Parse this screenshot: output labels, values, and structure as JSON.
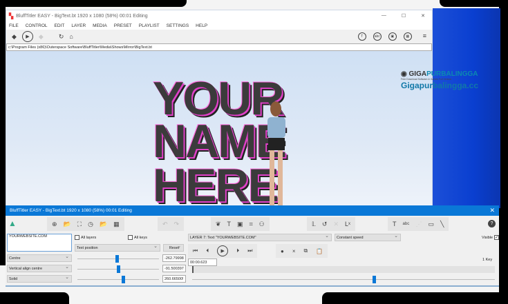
{
  "main_window": {
    "title": "BluffTitler EASY  - BigText.bt 1920 x 1080 (58%) 00:01 Editing",
    "menu": [
      "FILE",
      "CONTROL",
      "EDIT",
      "LAYER",
      "MEDIA",
      "PRESET",
      "PLAYLIST",
      "SETTINGS",
      "HELP"
    ],
    "path": "c:\\Program Files (x86)\\Outerspace Software\\BluffTitler\\Media\\Shows\\Mirror\\BigText.bt"
  },
  "scene": {
    "lines": [
      "YOUR",
      "NAME",
      "HERE"
    ]
  },
  "watermark": {
    "brand": "GIGA",
    "brand2": "PURBALINGGA",
    "tagline": "Free Download Software & Games Full Version",
    "url": "Gigapurbalingga.cc"
  },
  "panel": {
    "title": "BluffTitler EASY  - BigText.bt 1920 x 1080 (58%) 00:01 Editing",
    "text_value": "YOURWEBSITE.COM",
    "all_layers": "All layers",
    "all_keys": "All keys",
    "property": "Text position",
    "reset": "Reset",
    "align": "Centre",
    "valign": "Vertical align centre",
    "style": "Solid",
    "values": [
      "-262.79998",
      "-91.500397",
      "260.66500!"
    ],
    "sliders": [
      0.48,
      0.5,
      0.56
    ],
    "layer": "LAYER 7: Text \"YOURWEBSITE.COM\"",
    "speed": "Constant speed",
    "visible": "Visible",
    "time": "00:00.623",
    "keys": "1 Key",
    "timeline_pos": 0.6
  }
}
